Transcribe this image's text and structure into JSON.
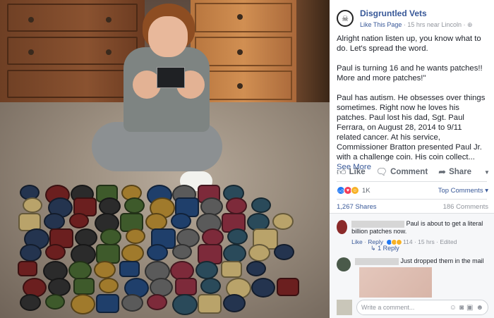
{
  "post": {
    "page_name": "Disgruntled Vets",
    "avatar_text": "☠",
    "like_page": "Like This Page",
    "time": "15 hrs near Lincoln",
    "separator": "·",
    "globe_icon": "globe-icon",
    "paragraph1": "Alright nation listen up, you know what to do. Let's spread the word.",
    "paragraph2": "Paul is turning 16 and he wants patches!! More and more patches!\"",
    "paragraph3": "Paul has autism. He obsesses over things sometimes. Right now he loves his patches. Paul lost his dad, Sgt. Paul Ferrara, on August 28, 2014 to 9/11 related cancer. At his service, Commissioner Bratton presented Paul Jr. with a challenge coin. His coin collect...",
    "see_more": "See More"
  },
  "actions": {
    "like": "Like",
    "comment": "Comment",
    "share": "Share"
  },
  "reactions": {
    "count": "1K",
    "top_comments": "Top Comments",
    "shares": "1,267 Shares",
    "comments": "186 Comments"
  },
  "comments": [
    {
      "text": "Paul is about to get a literal billion patches now.",
      "like": "Like",
      "reply": "Reply",
      "react_count": "114",
      "time": "15 hrs",
      "edited": "Edited",
      "replies": "1 Reply"
    },
    {
      "text": "Just dropped them in the mail"
    }
  ],
  "composer": {
    "placeholder": "Write a comment..."
  },
  "colors": {
    "link": "#385898",
    "like_react": "#2078f4",
    "love_react": "#f33e58",
    "haha_react": "#f7b125"
  }
}
